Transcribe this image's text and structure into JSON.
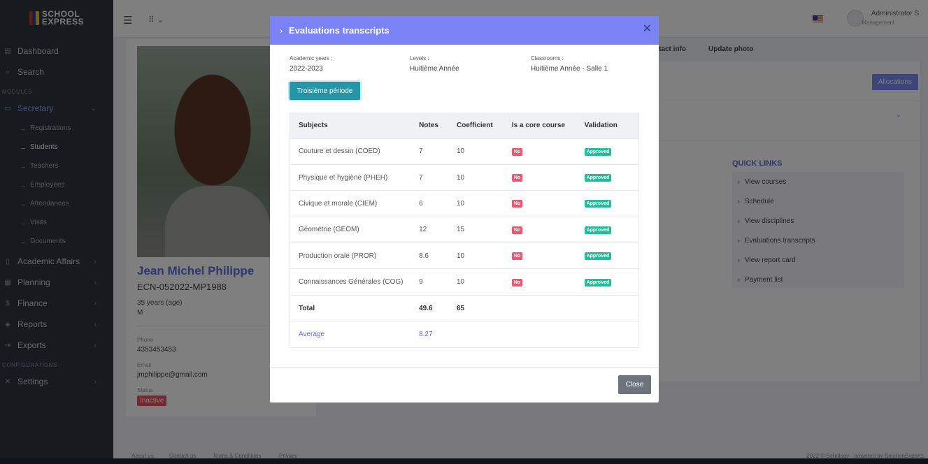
{
  "app": {
    "logo_line1": "SCHOOL",
    "logo_line2": "EXPRESS"
  },
  "sidebar": {
    "dashboard": "Dashboard",
    "search": "Search",
    "section_modules": "MODULES",
    "secretary": "Secretary",
    "sub_items": [
      "Registrations",
      "Students",
      "Teachers",
      "Employees",
      "Attendances",
      "Visits",
      "Documents"
    ],
    "academic_affairs": "Academic Affairs",
    "planning": "Planning",
    "finance": "Finance",
    "reports": "Reports",
    "exports": "Exports",
    "section_configurations": "CONFIGURATIONS",
    "settings": "Settings"
  },
  "header": {
    "admin_name": "Administrator S.",
    "admin_role": "Management"
  },
  "profile": {
    "name": "Jean Michel Philippe",
    "id": "ECN-052022-MP1988",
    "age": "35 years (age)",
    "sex": "M",
    "phone_label": "Phone",
    "phone": "4353453453",
    "email_label": "Email",
    "email": "jmphilippe@gmail.com",
    "status_label": "Status",
    "status": "Inactive"
  },
  "right": {
    "tab_contact": "ntact info",
    "tab_photo": "Update photo",
    "allocations": "Allocations",
    "quick_links_title": "QUICK LINKS",
    "quick_links": [
      "View courses",
      "Schedule",
      "View disciplines",
      "Evaluations transcripts",
      "View report card",
      "Payment list"
    ]
  },
  "footer": {
    "links": [
      "About us",
      "Contact us",
      "Terms & Conditions",
      "Privacy"
    ],
    "copyright": "2022 © Schology - powered by SolutionExperts"
  },
  "modal": {
    "title": "Evaluations transcripts",
    "academic_years_label": "Academic years :",
    "academic_years": "2022-2023",
    "levels_label": "Levels :",
    "levels": "Huitième Année",
    "classrooms_label": "Classrooms :",
    "classrooms": "Huitième Année - Salle 1",
    "period_button": "Troisième période",
    "columns": [
      "Subjects",
      "Notes",
      "Coefficient",
      "Is a core course",
      "Validation"
    ],
    "rows": [
      {
        "subject": "Couture et dessin (COED)",
        "note": "7",
        "coef": "10",
        "core": "No",
        "validation": "Approved"
      },
      {
        "subject": "Physique et hygiène (PHEH)",
        "note": "7",
        "coef": "10",
        "core": "No",
        "validation": "Approved"
      },
      {
        "subject": "Civique et morale (CIEM)",
        "note": "6",
        "coef": "10",
        "core": "No",
        "validation": "Approved"
      },
      {
        "subject": "Géométrie (GEOM)",
        "note": "12",
        "coef": "15",
        "core": "No",
        "validation": "Approved"
      },
      {
        "subject": "Production orale (PROR)",
        "note": "8.6",
        "coef": "10",
        "core": "No",
        "validation": "Approved"
      },
      {
        "subject": "Connaissances Générales (COG)",
        "note": "9",
        "coef": "10",
        "core": "No",
        "validation": "Approved"
      }
    ],
    "total_label": "Total",
    "total_notes": "49.6",
    "total_coef": "65",
    "average_label": "Average",
    "average": "8.27",
    "close_button": "Close"
  }
}
